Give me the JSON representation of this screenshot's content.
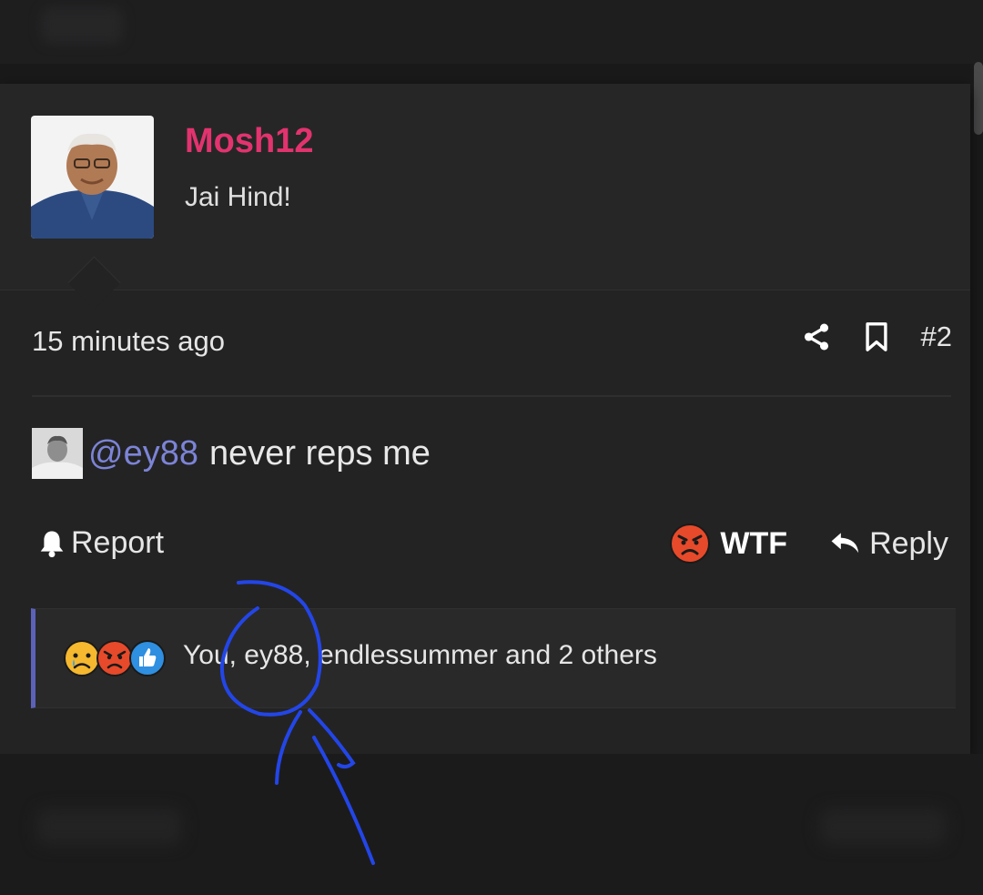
{
  "post": {
    "author": {
      "username": "Mosh12",
      "user_title": "Jai Hind!",
      "avatar_icon": "user-avatar-photo",
      "username_color": "#e2336f"
    },
    "time": "15 minutes ago",
    "post_number": "#2",
    "share_icon": "share-icon",
    "bookmark_icon": "bookmark-icon",
    "content": {
      "mention": "@ey88",
      "text": "never reps me",
      "mention_color": "#7c84d6"
    },
    "actions": {
      "report_label": "Report",
      "reaction_label": "WTF",
      "reply_label": "Reply"
    },
    "reactions": {
      "icons": [
        "sad-face-icon",
        "angry-face-icon",
        "thumbs-up-icon"
      ],
      "summary": "You, ey88, endlessummer and 2 others",
      "accent_color": "#5b62b8"
    }
  },
  "annotation": {
    "type": "hand-drawn circle and arrow",
    "color": "#2346e8"
  }
}
